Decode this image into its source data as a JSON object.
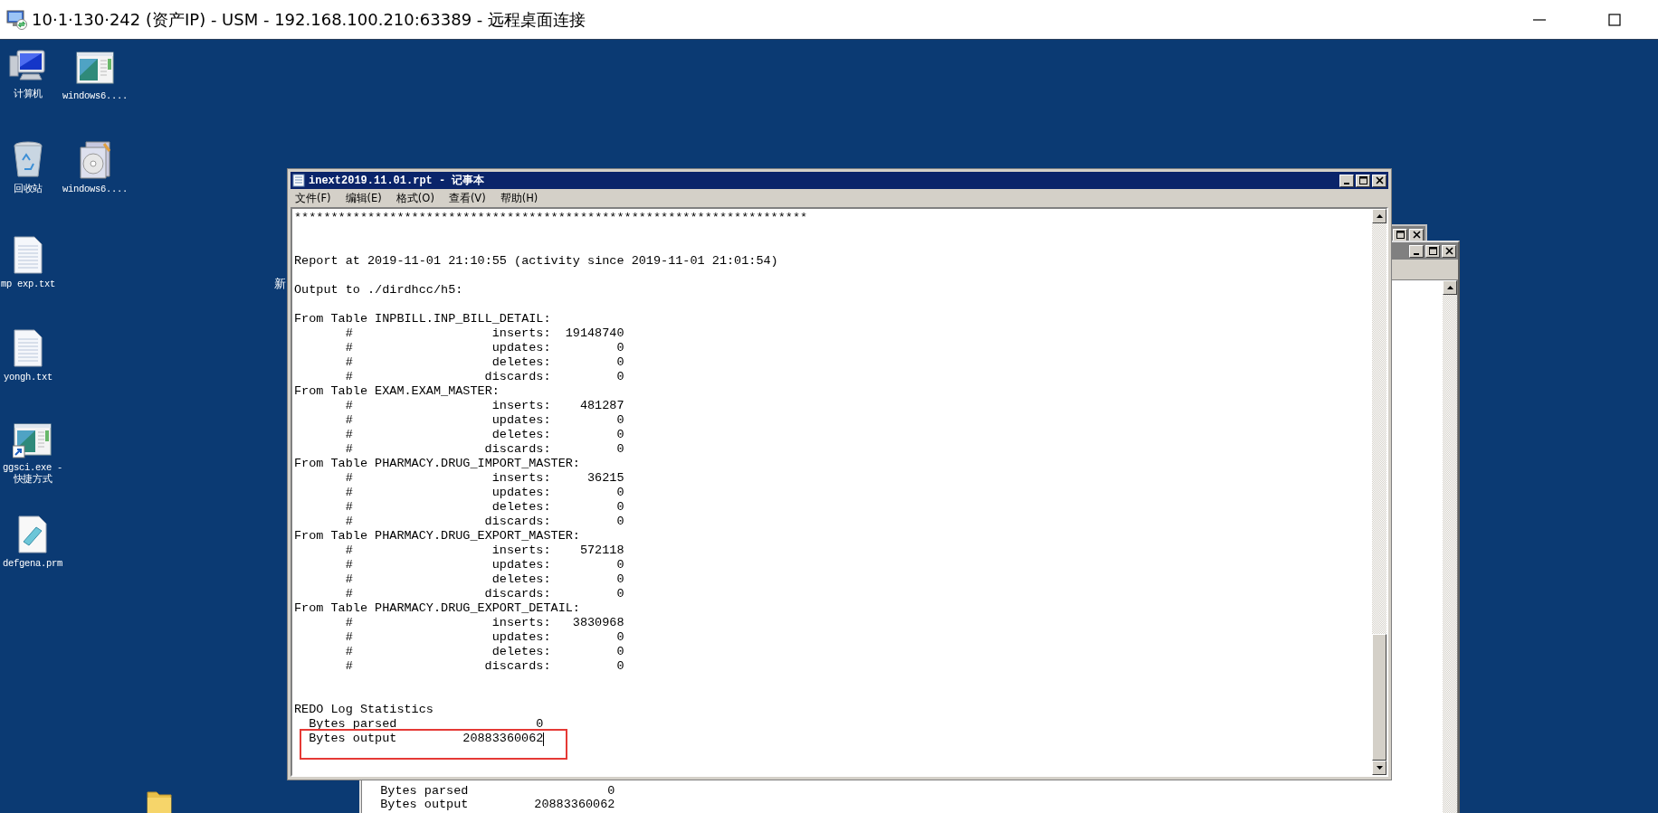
{
  "remote_desktop": {
    "title": "10·1·130·242 (资产IP) - USM - 192.168.100.210:63389 - 远程桌面连接"
  },
  "desktop_icons": [
    {
      "kind": "computer",
      "label_lines": [
        "计算机"
      ]
    },
    {
      "kind": "app-window",
      "label_lines": [
        "windows6...."
      ]
    },
    {
      "kind": "recycle-bin",
      "label_lines": [
        "回收站"
      ]
    },
    {
      "kind": "installer",
      "label_lines": [
        "windows6...."
      ]
    },
    {
      "kind": "text-file",
      "label_lines": [
        "mp exp.txt"
      ]
    },
    {
      "kind": "text-file",
      "label_lines": [
        "yongh.txt"
      ]
    },
    {
      "kind": "app-shortcut",
      "label_lines": [
        "ggsci.exe -",
        "快捷方式"
      ]
    },
    {
      "kind": "notepad-file",
      "label_lines": [
        "defgena.prm"
      ]
    },
    {
      "kind": "hidden",
      "label_lines": [
        "新"
      ]
    },
    {
      "kind": "folder"
    }
  ],
  "background_window": {
    "rows": [
      {
        "label": "Bytes parsed",
        "value": "0"
      },
      {
        "label": "Bytes output",
        "value": "20883360062"
      }
    ]
  },
  "notepad": {
    "title": "inext2019.11.01.rpt - 记事本",
    "menu": [
      "文件(F)",
      "编辑(E)",
      "格式(O)",
      "查看(V)",
      "帮助(H)"
    ],
    "separator": "**********************************************************************",
    "report_line": "Report at 2019-11-01 21:10:55 (activity since 2019-11-01 21:01:54)",
    "output_line": "Output to ./dirdhcc/h5:",
    "tables": [
      {
        "heading": "From Table INPBILL.INP_BILL_DETAIL:",
        "rows": [
          {
            "mark": "#",
            "label": "inserts:",
            "value": "19148740"
          },
          {
            "mark": "#",
            "label": "updates:",
            "value": "0"
          },
          {
            "mark": "#",
            "label": "deletes:",
            "value": "0"
          },
          {
            "mark": "#",
            "label": "discards:",
            "value": "0"
          }
        ]
      },
      {
        "heading": "From Table EXAM.EXAM_MASTER:",
        "rows": [
          {
            "mark": "#",
            "label": "inserts:",
            "value": "481287"
          },
          {
            "mark": "#",
            "label": "updates:",
            "value": "0"
          },
          {
            "mark": "#",
            "label": "deletes:",
            "value": "0"
          },
          {
            "mark": "#",
            "label": "discards:",
            "value": "0"
          }
        ]
      },
      {
        "heading": "From Table PHARMACY.DRUG_IMPORT_MASTER:",
        "rows": [
          {
            "mark": "#",
            "label": "inserts:",
            "value": "36215"
          },
          {
            "mark": "#",
            "label": "updates:",
            "value": "0"
          },
          {
            "mark": "#",
            "label": "deletes:",
            "value": "0"
          },
          {
            "mark": "#",
            "label": "discards:",
            "value": "0"
          }
        ]
      },
      {
        "heading": "From Table PHARMACY.DRUG_EXPORT_MASTER:",
        "rows": [
          {
            "mark": "#",
            "label": "inserts:",
            "value": "572118"
          },
          {
            "mark": "#",
            "label": "updates:",
            "value": "0"
          },
          {
            "mark": "#",
            "label": "deletes:",
            "value": "0"
          },
          {
            "mark": "#",
            "label": "discards:",
            "value": "0"
          }
        ]
      },
      {
        "heading": "From Table PHARMACY.DRUG_EXPORT_DETAIL:",
        "rows": [
          {
            "mark": "#",
            "label": "inserts:",
            "value": "3830968"
          },
          {
            "mark": "#",
            "label": "updates:",
            "value": "0"
          },
          {
            "mark": "#",
            "label": "deletes:",
            "value": "0"
          },
          {
            "mark": "#",
            "label": "discards:",
            "value": "0"
          }
        ]
      }
    ],
    "redo": {
      "heading": "REDO Log Statistics",
      "rows": [
        {
          "label": "Bytes parsed",
          "value": "0",
          "highlighted": false,
          "caret": false
        },
        {
          "label": "Bytes output",
          "value": "20883360062",
          "highlighted": true,
          "caret": true
        }
      ]
    }
  }
}
